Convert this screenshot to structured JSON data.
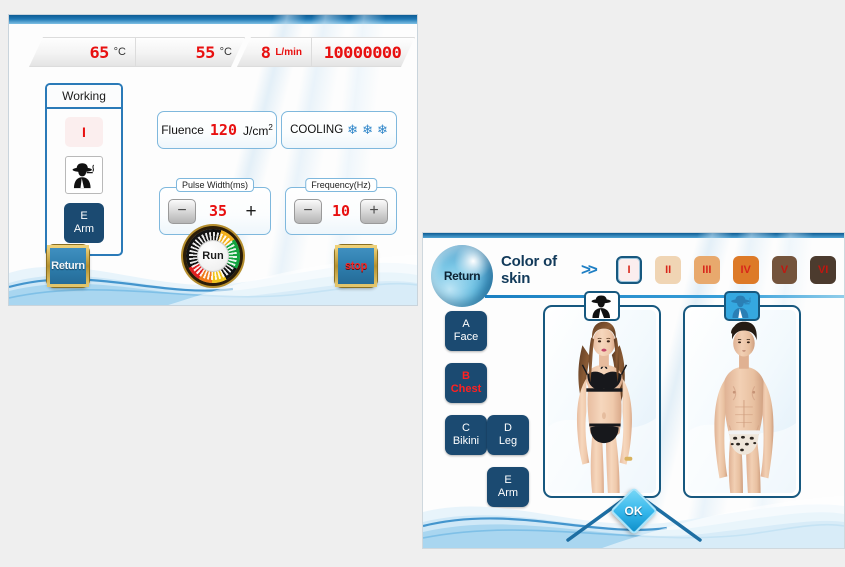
{
  "left_screen": {
    "readouts": [
      {
        "id": "water-temp-in",
        "value": "65",
        "unit": "°C",
        "unit_style": "dark"
      },
      {
        "id": "water-temp-out",
        "value": "55",
        "unit": "°C",
        "unit_style": "dark"
      },
      {
        "id": "flow-rate",
        "value": "8",
        "unit": "L/min",
        "unit_style": "red"
      },
      {
        "id": "shot-counter",
        "value": "10000000",
        "unit": "",
        "unit_style": "none"
      }
    ],
    "working_box": {
      "title": "Working",
      "mode_indicator": "I",
      "person_icon": "person-silhouette-icon",
      "region_code": "E",
      "region_name": "Arm"
    },
    "fluence": {
      "label": "Fluence",
      "value": "120",
      "unit": "J/cm",
      "unit_sup": "2"
    },
    "cooling": {
      "label": "COOLING",
      "level_icons": [
        "snowflake-icon",
        "snowflake-icon",
        "snowflake-icon"
      ]
    },
    "pulse_width": {
      "legend": "Pulse Width(ms)",
      "value": "35",
      "minus": "−",
      "plus": "+"
    },
    "frequency": {
      "legend": "Frequency(Hz)",
      "value": "10",
      "minus": "−",
      "plus": "+"
    },
    "buttons": {
      "return": "Return",
      "run": "Run",
      "stop": "stop"
    }
  },
  "right_screen": {
    "return_button": "Return",
    "skin_header": {
      "title": "Color of skin",
      "arrows": "»"
    },
    "skin_tones": [
      {
        "label": "I",
        "color": "#fbeeee",
        "selected": true
      },
      {
        "label": "II",
        "color": "#f0d5b4",
        "selected": false
      },
      {
        "label": "III",
        "color": "#e8a96d",
        "selected": false
      },
      {
        "label": "IV",
        "color": "#dd7a28",
        "selected": false
      },
      {
        "label": "V",
        "color": "#74543c",
        "selected": false
      },
      {
        "label": "VI",
        "color": "#4c3b2e",
        "selected": false
      }
    ],
    "body_parts": [
      {
        "code": "A",
        "name": "Face",
        "active": false
      },
      {
        "code": "B",
        "name": "Chest",
        "active": true
      },
      {
        "code": "C",
        "name": "Bikini",
        "active": false
      },
      {
        "code": "D",
        "name": "Leg",
        "active": false
      },
      {
        "code": "E",
        "name": "Arm",
        "active": false
      }
    ],
    "gender_cards": [
      {
        "id": "female",
        "icon": "female-silhouette-icon",
        "selected": false,
        "photo": "female-model-bikini-photo"
      },
      {
        "id": "male",
        "icon": "male-silhouette-icon",
        "selected": true,
        "photo": "male-model-swimwear-photo"
      }
    ],
    "ok_button": "OK"
  },
  "colors": {
    "accent_blue": "#1a7fc1",
    "dark_blue": "#1b4a71",
    "digit_red": "#e81010",
    "gold": "#b5912f"
  }
}
